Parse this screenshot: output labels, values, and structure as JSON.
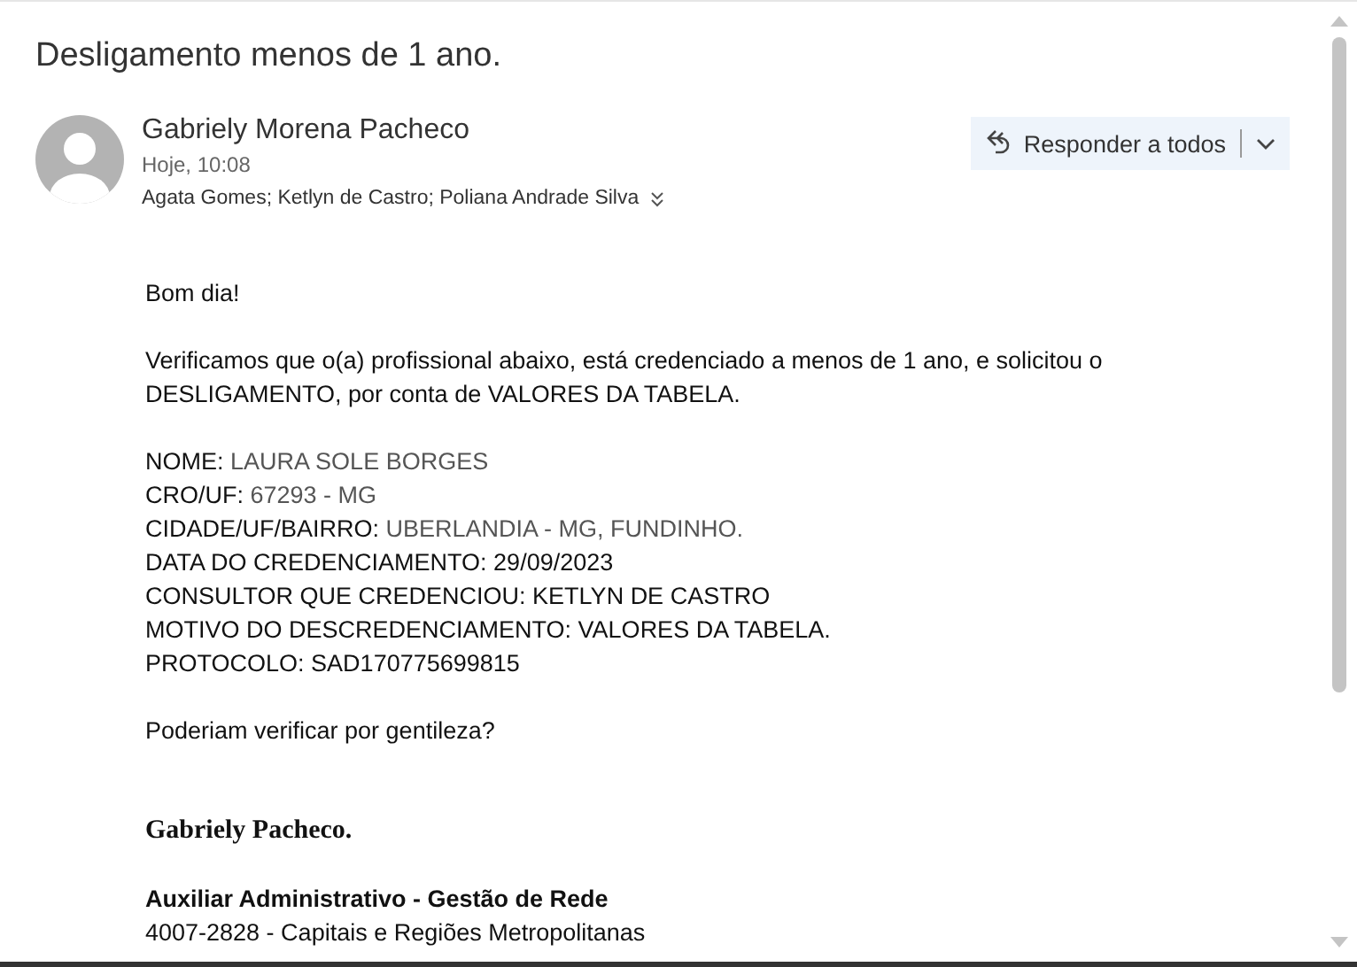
{
  "subject": "Desligamento menos de 1 ano.",
  "sender": {
    "name": "Gabriely Morena Pacheco",
    "time": "Hoje, 10:08",
    "recipients": "Agata Gomes; Ketlyn de Castro; Poliana Andrade Silva"
  },
  "reply_button": {
    "label": "Responder a todos"
  },
  "body": {
    "greeting": "Bom dia!",
    "intro": "Verificamos que o(a) profissional abaixo, está credenciado a menos de 1 ano, e solicitou o DESLIGAMENTO, por conta de VALORES DA TABELA.",
    "fields": [
      {
        "label": "NOME:",
        "value": "LAURA SOLE BORGES",
        "muted": true
      },
      {
        "label": "CRO/UF:",
        "value": "67293 - MG",
        "muted": true
      },
      {
        "label": "CIDADE/UF/BAIRRO:",
        "value": "UBERLANDIA - MG, FUNDINHO.",
        "muted": true
      },
      {
        "label": "DATA DO CREDENCIAMENTO:",
        "value": "29/09/2023",
        "muted": false
      },
      {
        "label": "CONSULTOR QUE CREDENCIOU:",
        "value": "KETLYN DE CASTRO",
        "muted": false
      },
      {
        "label": "MOTIVO DO DESCREDENCIAMENTO:",
        "value": "VALORES DA TABELA.",
        "muted": false
      },
      {
        "label": "PROTOCOLO:",
        "value": "SAD170775699815",
        "muted": false
      }
    ],
    "question": "Poderiam verificar por gentileza?"
  },
  "signature": {
    "name": "Gabriely Pacheco.",
    "role": "Auxiliar Administrativo - Gestão de Rede",
    "phone": "4007-2828 - Capitais e Regiões Metropolitanas"
  }
}
